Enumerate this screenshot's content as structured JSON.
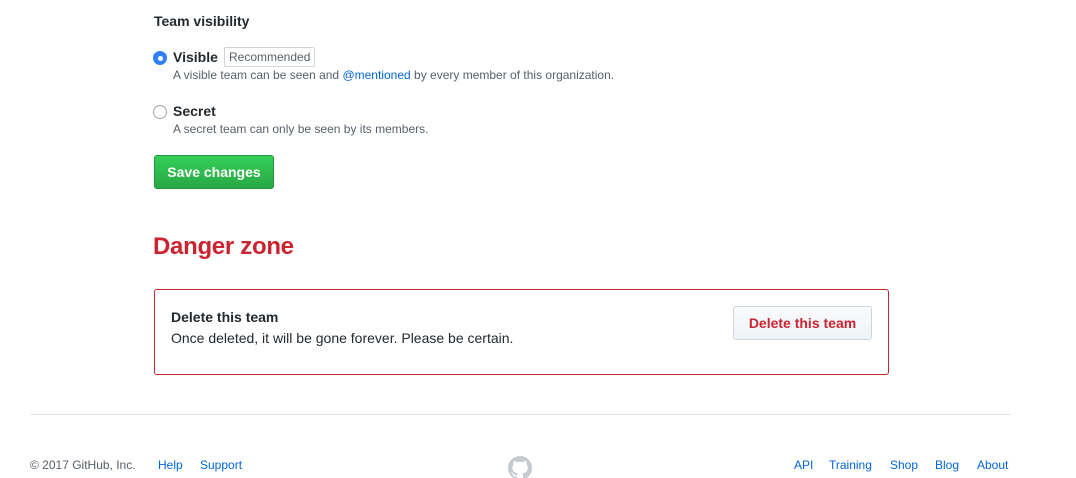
{
  "visibility": {
    "title": "Team visibility",
    "options": [
      {
        "label": "Visible",
        "badge": "Recommended",
        "note_pre": "A visible team can be seen and ",
        "note_link": "@mentioned",
        "note_post": " by every member of this organization.",
        "selected": true
      },
      {
        "label": "Secret",
        "note": "A secret team can only be seen by its members.",
        "selected": false
      }
    ],
    "save_label": "Save changes"
  },
  "danger": {
    "title": "Danger zone",
    "item_title": "Delete this team",
    "item_desc": "Once deleted, it will be gone forever. Please be certain.",
    "button_label": "Delete this team"
  },
  "footer": {
    "copyright": "© 2017 GitHub, Inc.",
    "left_links": [
      "Help",
      "Support"
    ],
    "logo_icon": "github-mark-icon",
    "right_links": [
      "API",
      "Training",
      "Shop",
      "Blog",
      "About"
    ]
  },
  "colors": {
    "primary_button": "#28a745",
    "danger": "#cb2431",
    "link": "#0366d6",
    "radio_selected": "#2f81f7"
  }
}
